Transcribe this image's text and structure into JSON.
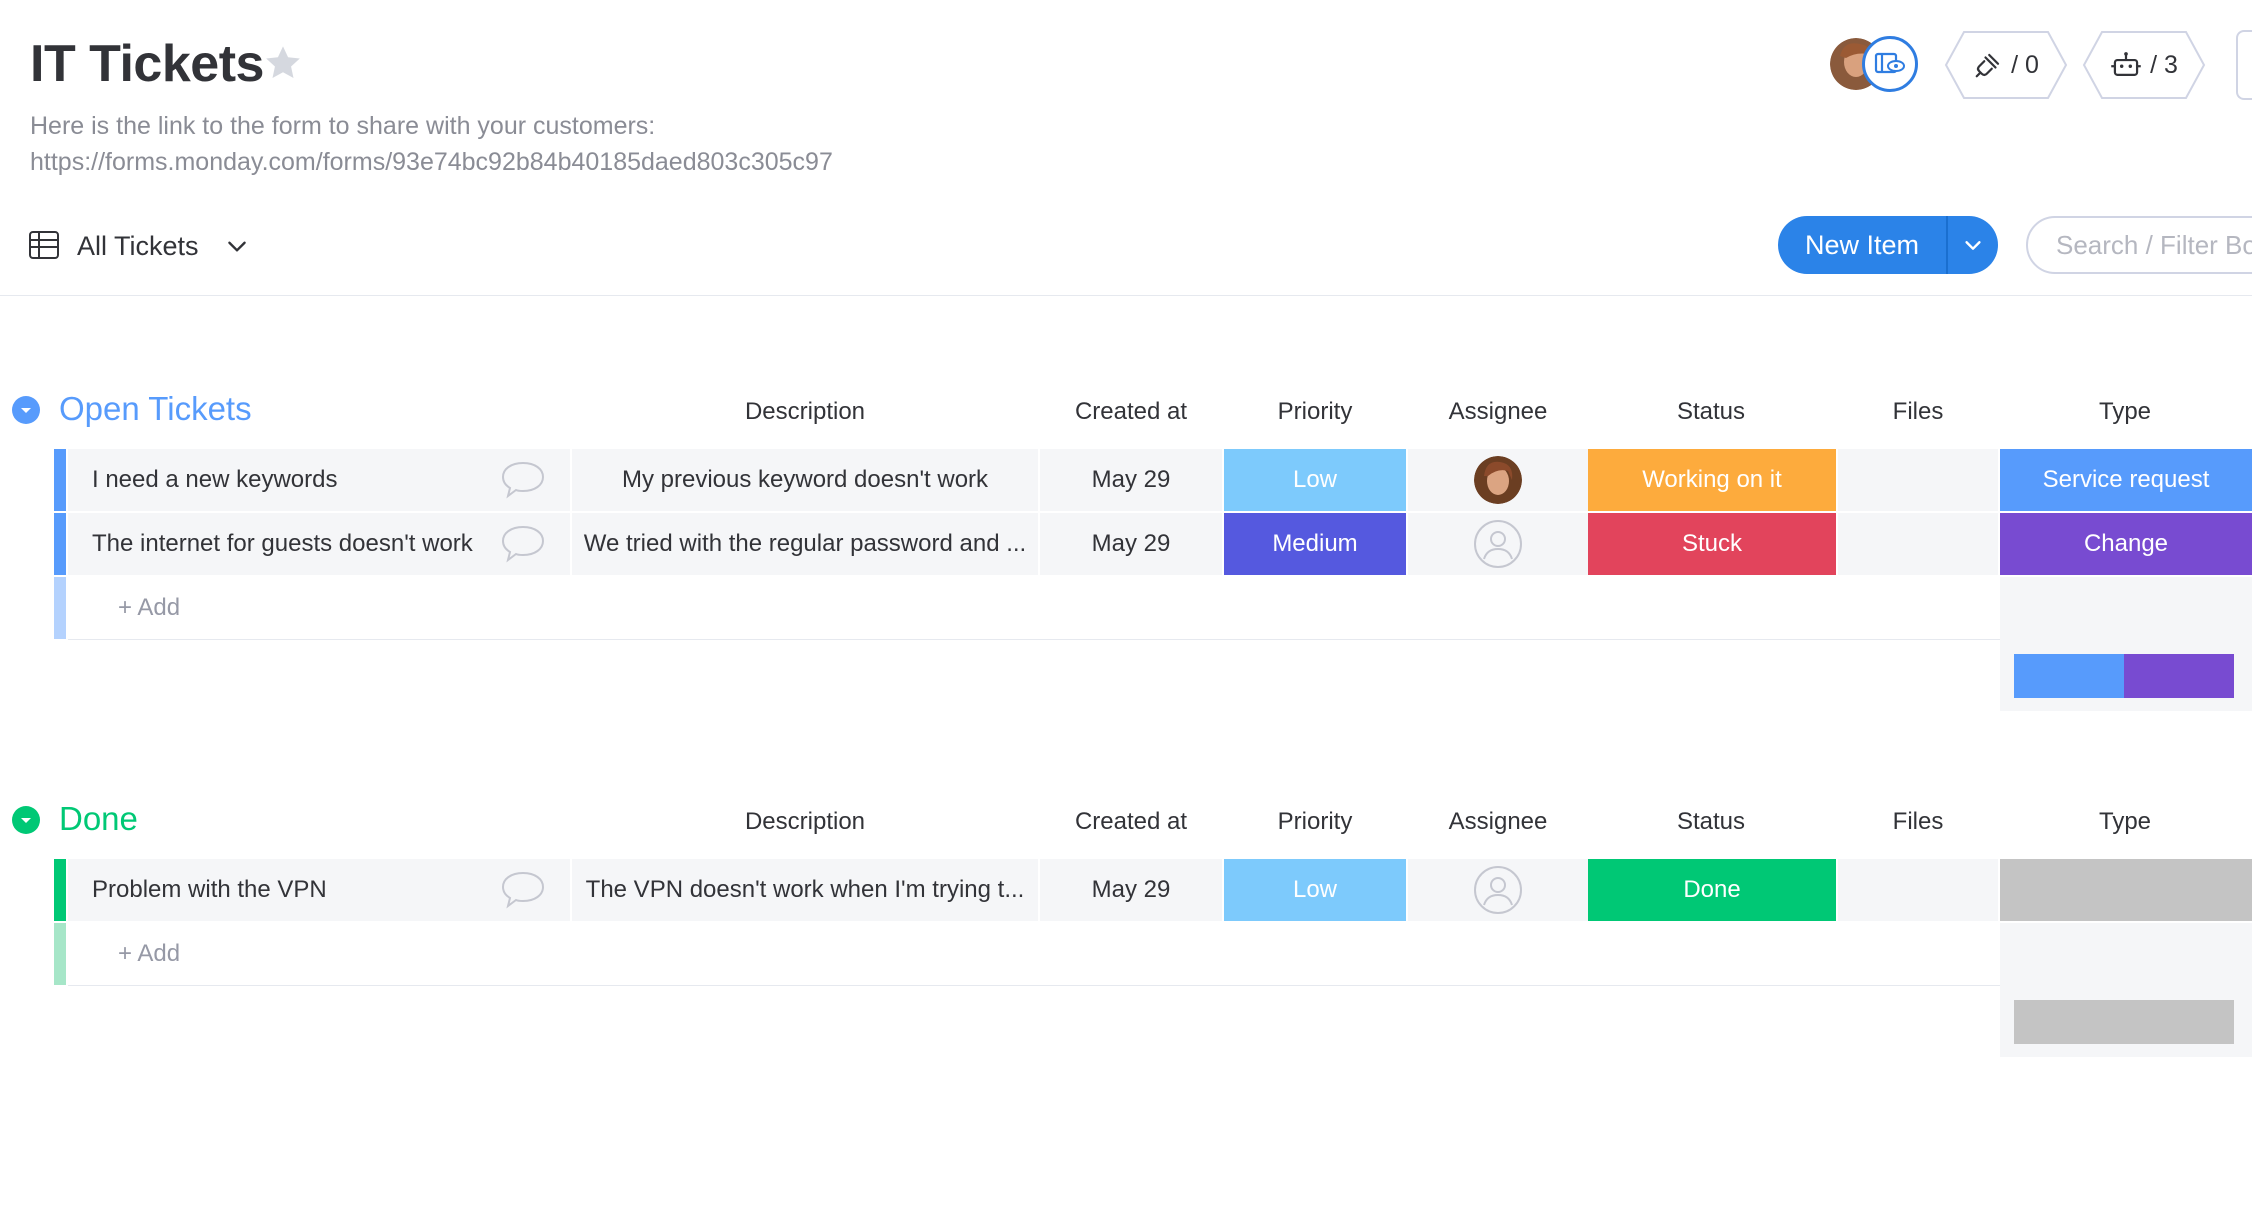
{
  "board": {
    "title": "IT Tickets",
    "description_line1": "Here is the link to the form to share with your customers:",
    "description_line2": "https://forms.monday.com/forms/93e74bc92b84b40185daed803c305c97"
  },
  "toolbar": {
    "integrations_count": "/ 0",
    "automations_count": "/ 3",
    "view_label": "All Tickets",
    "new_item_label": "New Item",
    "search_placeholder": "Search / Filter Board"
  },
  "columns": {
    "description": "Description",
    "created_at": "Created at",
    "priority": "Priority",
    "assignee": "Assignee",
    "status": "Status",
    "files": "Files",
    "type": "Type"
  },
  "colors": {
    "open_group": "#579bfc",
    "done_group": "#00c875",
    "low": "#7dcafc",
    "medium": "#5559df",
    "working_on_it": "#fdab3d",
    "stuck": "#e2445c",
    "done": "#00c875",
    "service_request": "#579bfc",
    "change": "#784bd1",
    "empty": "#c4c4c4"
  },
  "groups": [
    {
      "title": "Open Tickets",
      "add_label": "+ Add",
      "items": [
        {
          "name": "I need a new keywords",
          "description": "My previous keyword doesn't work",
          "created_at": "May 29",
          "priority": "Low",
          "assignee": "avatar",
          "status": "Working on it",
          "files": "",
          "type": "Service request"
        },
        {
          "name": "The internet for guests doesn't work",
          "description": "We tried with the regular password and ...",
          "created_at": "May 29",
          "priority": "Medium",
          "assignee": "empty",
          "status": "Stuck",
          "files": "",
          "type": "Change"
        }
      ],
      "type_summary": [
        {
          "label": "Service request",
          "fraction": 0.5
        },
        {
          "label": "Change",
          "fraction": 0.5
        }
      ]
    },
    {
      "title": "Done",
      "add_label": "+ Add",
      "items": [
        {
          "name": "Problem with the VPN",
          "description": "The VPN doesn't work when I'm trying t...",
          "created_at": "May 29",
          "priority": "Low",
          "assignee": "empty",
          "status": "Done",
          "files": "",
          "type": ""
        }
      ],
      "type_summary": [
        {
          "label": "",
          "fraction": 1.0
        }
      ]
    }
  ]
}
